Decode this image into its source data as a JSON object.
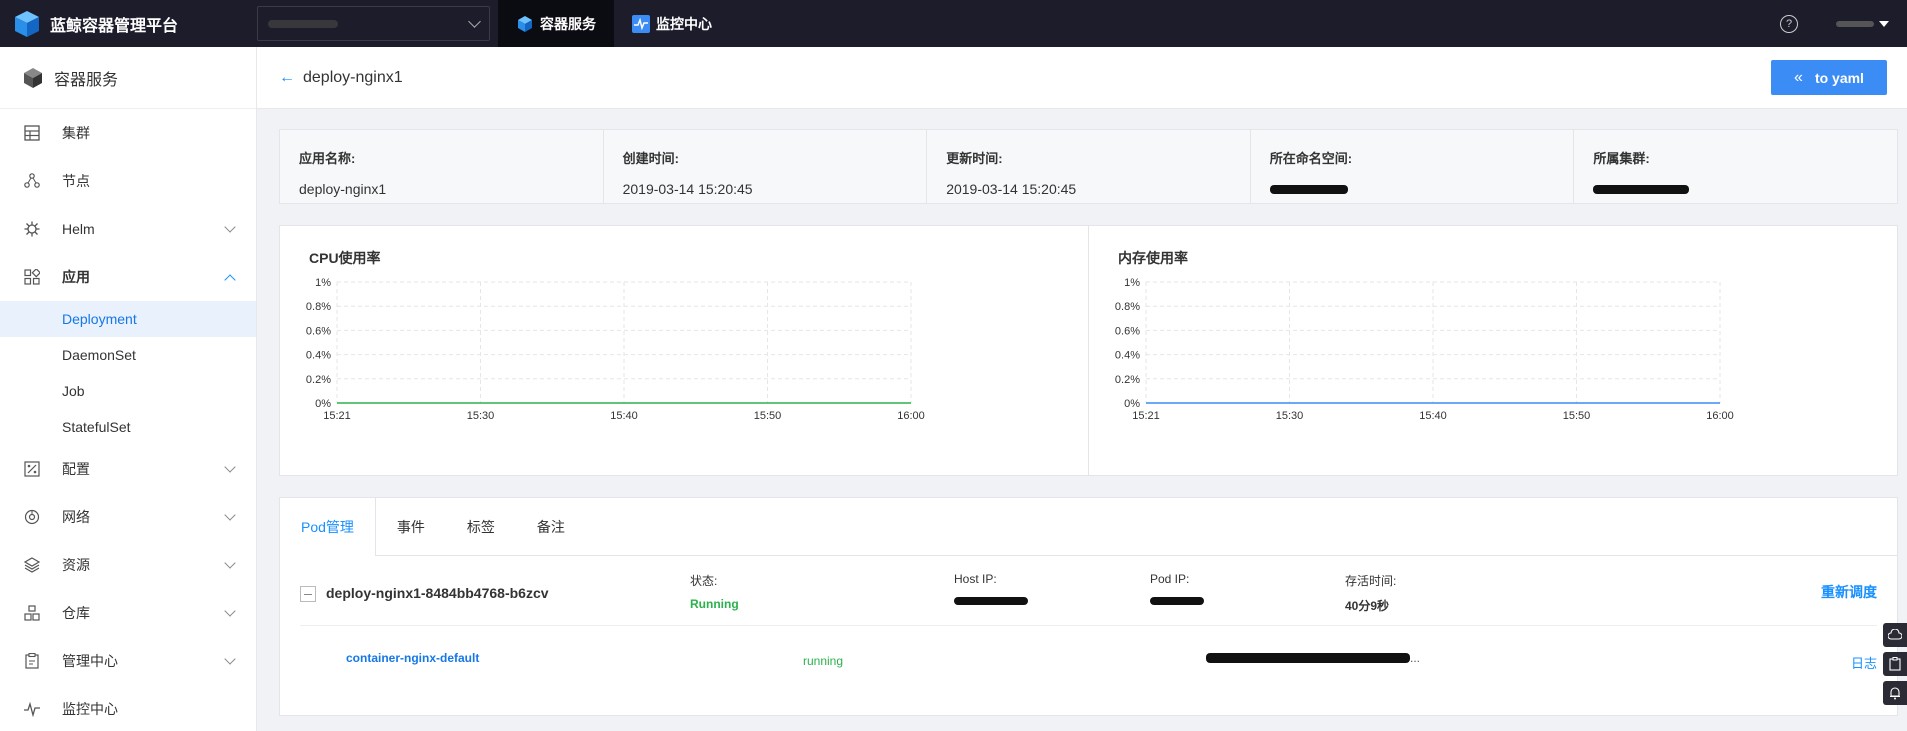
{
  "topbar": {
    "app_title": "蓝鲸容器管理平台",
    "nav": [
      {
        "label": "容器服务",
        "active": true
      },
      {
        "label": "监控中心",
        "active": false
      }
    ],
    "help_glyph": "?"
  },
  "sidebar": {
    "title": "容器服务",
    "items": [
      {
        "label": "集群",
        "icon": "grid-icon"
      },
      {
        "label": "节点",
        "icon": "nodes-icon"
      },
      {
        "label": "Helm",
        "icon": "helm-icon"
      },
      {
        "label": "应用",
        "icon": "apps-icon"
      },
      {
        "label": "配置",
        "icon": "config-icon"
      },
      {
        "label": "网络",
        "icon": "network-icon"
      },
      {
        "label": "资源",
        "icon": "layers-icon"
      },
      {
        "label": "仓库",
        "icon": "warehouse-icon"
      },
      {
        "label": "管理中心",
        "icon": "clipboard-icon"
      },
      {
        "label": "监控中心",
        "icon": "pulse-icon"
      }
    ],
    "sub_items": [
      {
        "label": "Deployment",
        "active": true
      },
      {
        "label": "DaemonSet"
      },
      {
        "label": "Job"
      },
      {
        "label": "StatefulSet"
      }
    ]
  },
  "header": {
    "back_arrow": "←",
    "title": "deploy-nginx1",
    "yaml_button": "to yaml",
    "yaml_icon": "«"
  },
  "info": [
    {
      "label": "应用名称:",
      "value": "deploy-nginx1"
    },
    {
      "label": "创建时间:",
      "value": "2019-03-14 15:20:45"
    },
    {
      "label": "更新时间:",
      "value": "2019-03-14 15:20:45"
    },
    {
      "label": "所在命名空间:",
      "value": null
    },
    {
      "label": "所属集群:",
      "value": null
    }
  ],
  "chart_data": [
    {
      "type": "line",
      "title": "CPU使用率",
      "x": [
        "15:21",
        "15:30",
        "15:40",
        "15:50",
        "16:00"
      ],
      "y_ticks": [
        "1%",
        "0.8%",
        "0.6%",
        "0.4%",
        "0.2%",
        "0%"
      ],
      "ylim": [
        0,
        1
      ],
      "series": [
        {
          "values": [
            0,
            0,
            0,
            0,
            0
          ]
        }
      ],
      "line_color": "#2bb24c",
      "grid": true
    },
    {
      "type": "line",
      "title": "内存使用率",
      "x": [
        "15:21",
        "15:30",
        "15:40",
        "15:50",
        "16:00"
      ],
      "y_ticks": [
        "1%",
        "0.8%",
        "0.6%",
        "0.4%",
        "0.2%",
        "0%"
      ],
      "ylim": [
        0,
        1
      ],
      "series": [
        {
          "values": [
            0,
            0,
            0,
            0,
            0
          ]
        }
      ],
      "line_color": "#3b8cf5",
      "grid": true
    }
  ],
  "pods": {
    "tabs": [
      "Pod管理",
      "事件",
      "标签",
      "备注"
    ],
    "pod": {
      "name": "deploy-nginx1-8484bb4768-b6zcv",
      "status_label": "状态:",
      "status_value": "Running",
      "host_ip_label": "Host IP:",
      "pod_ip_label": "Pod IP:",
      "age_label": "存活时间:",
      "age_value": "40分9秒",
      "action": "重新调度"
    },
    "container": {
      "name": "container-nginx-default",
      "status": "running",
      "image_suffix": "...",
      "action": "日志"
    }
  }
}
